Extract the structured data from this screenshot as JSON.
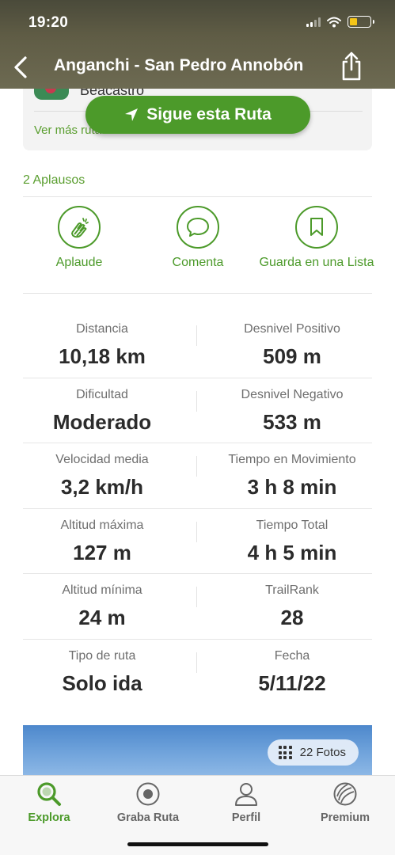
{
  "status_bar": {
    "time": "19:20"
  },
  "header": {
    "title": "Anganchi - San Pedro Annobón"
  },
  "author": {
    "name": "Beacastro",
    "more_routes": "Ver más rutas de este autor >"
  },
  "follow_button": {
    "label": "Sigue esta Ruta"
  },
  "applause": {
    "count_text": "2 Aplausos"
  },
  "actions": [
    {
      "label": "Aplaude",
      "icon": "clap-icon"
    },
    {
      "label": "Comenta",
      "icon": "comment-icon"
    },
    {
      "label": "Guarda en una Lista",
      "icon": "bookmark-icon"
    }
  ],
  "stats": [
    {
      "left": {
        "label": "Distancia",
        "value": "10,18 km"
      },
      "right": {
        "label": "Desnivel Positivo",
        "value": "509 m"
      }
    },
    {
      "left": {
        "label": "Dificultad",
        "value": "Moderado"
      },
      "right": {
        "label": "Desnivel Negativo",
        "value": "533 m"
      }
    },
    {
      "left": {
        "label": "Velocidad media",
        "value": "3,2 km/h"
      },
      "right": {
        "label": "Tiempo en Movimiento",
        "value": "3 h 8 min"
      }
    },
    {
      "left": {
        "label": "Altitud máxima",
        "value": "127 m"
      },
      "right": {
        "label": "Tiempo Total",
        "value": "4 h 5 min"
      }
    },
    {
      "left": {
        "label": "Altitud mínima",
        "value": "24 m"
      },
      "right": {
        "label": "TrailRank",
        "value": "28"
      }
    },
    {
      "left": {
        "label": "Tipo de ruta",
        "value": "Solo ida"
      },
      "right": {
        "label": "Fecha",
        "value": "5/11/22"
      }
    }
  ],
  "photos": {
    "badge": "22 Fotos"
  },
  "tabbar": [
    {
      "label": "Explora",
      "icon": "explore-icon",
      "active": true
    },
    {
      "label": "Graba Ruta",
      "icon": "record-icon",
      "active": false
    },
    {
      "label": "Perfil",
      "icon": "profile-icon",
      "active": false
    },
    {
      "label": "Premium",
      "icon": "premium-icon",
      "active": false
    }
  ],
  "colors": {
    "accent": "#4c9a2a",
    "header_bg": "#5f5c45",
    "battery": "#f5c518"
  }
}
